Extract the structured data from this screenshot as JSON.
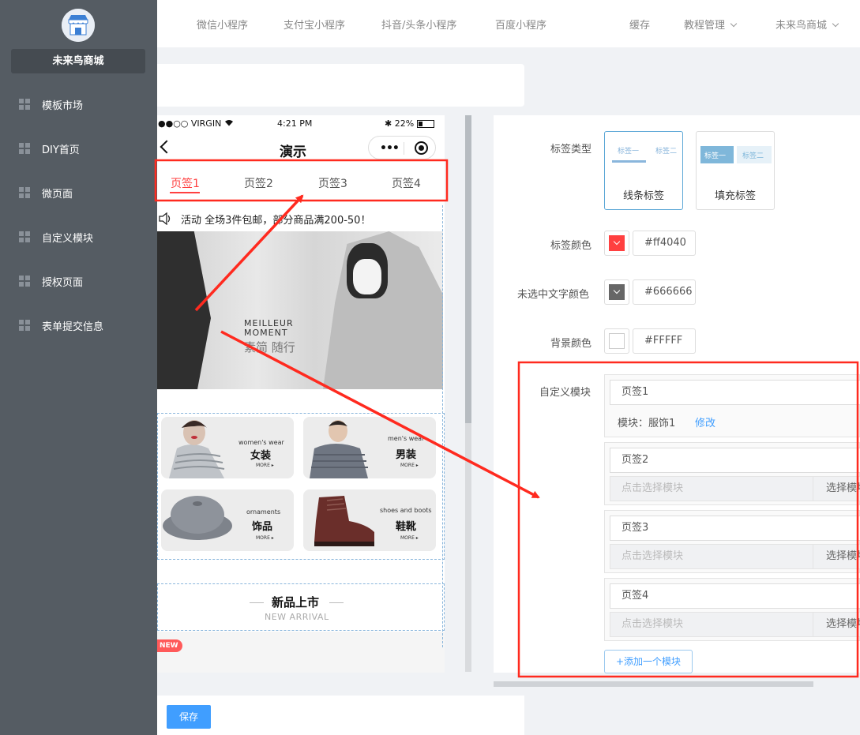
{
  "sidebar": {
    "shop_name": "未来鸟商城",
    "items": [
      {
        "label": "模板市场"
      },
      {
        "label": "DIY首页"
      },
      {
        "label": "微页面"
      },
      {
        "label": "自定义模块"
      },
      {
        "label": "授权页面"
      },
      {
        "label": "表单提交信息"
      }
    ]
  },
  "topnav": {
    "items": [
      "微信小程序",
      "支付宝小程序",
      "抖音/头条小程序",
      "百度小程序"
    ],
    "cache": "缓存",
    "tutorial": "教程管理",
    "store": "未来鸟商城"
  },
  "phone": {
    "status": {
      "carrier": "●●○○ VIRGIN",
      "time": "4:21 PM",
      "battery": "22%"
    },
    "title": "演示",
    "tabs": [
      "页签1",
      "页签2",
      "页签3",
      "页签4"
    ],
    "notice": "活动  全场3件包邮，部分商品满200-50！",
    "banner": {
      "line1": "MEILLEUR",
      "line2": "MOMENT",
      "line3": "素简 随行"
    },
    "grid": [
      {
        "en": "women's wear",
        "cn": "女装",
        "more": "MORE ▸"
      },
      {
        "en": "men's wear",
        "cn": "男装",
        "more": "MORE ▸"
      },
      {
        "en": "ornaments",
        "cn": "饰品",
        "more": "MORE ▸"
      },
      {
        "en": "shoes and boots",
        "cn": "鞋靴",
        "more": "MORE ▸"
      }
    ],
    "arrival": {
      "cn": "新品上市",
      "en": "NEW ARRIVAL"
    },
    "new_badge": "NEW"
  },
  "panel": {
    "tag_type_label": "标签类型",
    "tag_types": [
      {
        "caption": "线条标签",
        "mini1": "标签一",
        "mini2": "标签二"
      },
      {
        "caption": "填充标签",
        "mini1": "标签一",
        "mini2": "标签二"
      }
    ],
    "tag_color_label": "标签颜色",
    "tag_color": "#ff4040",
    "unselected_label": "未选中文字颜色",
    "unselected_color": "#666666",
    "bg_label": "背景颜色",
    "bg_color": "#FFFFF",
    "custom_label": "自定义模块",
    "modules": [
      {
        "name": "页签1",
        "module_prefix": "模块：",
        "module": "服饰1",
        "edit": "修改"
      },
      {
        "name": "页签2",
        "placeholder": "点击选择模块",
        "select": "选择模块"
      },
      {
        "name": "页签3",
        "placeholder": "点击选择模块",
        "select": "选择模块"
      },
      {
        "name": "页签4",
        "placeholder": "点击选择模块",
        "select": "选择模块"
      }
    ],
    "add_button": "+添加一个模块"
  },
  "footer": {
    "save": "保存"
  },
  "colors": {
    "accent": "#409eff",
    "tab_active": "#ff4040",
    "sidebar_bg": "#555c63",
    "annotation": "#ff2a1f"
  }
}
